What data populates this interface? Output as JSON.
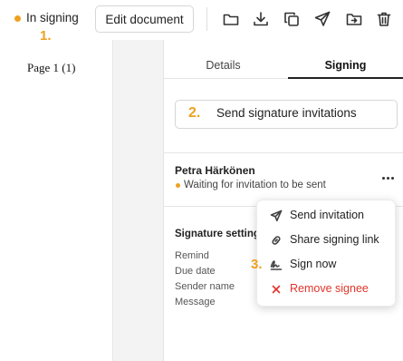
{
  "colors": {
    "accent": "#f0a020",
    "danger": "#e0352b",
    "text": "#222222"
  },
  "toolbar": {
    "status_label": "In signing",
    "step_1": "1.",
    "edit_document_label": "Edit document",
    "icons": [
      "folder-icon",
      "download-icon",
      "copy-icon",
      "send-icon",
      "move-to-folder-icon",
      "trash-icon"
    ]
  },
  "document": {
    "page_label": "Page  1 (1)"
  },
  "panel": {
    "tabs": [
      {
        "label": "Details",
        "active": false
      },
      {
        "label": "Signing",
        "active": true
      }
    ],
    "step_2": "2.",
    "send_invitations_label": "Send signature invitations",
    "signee": {
      "name": "Petra Härkönen",
      "status": "Waiting for invitation to be sent"
    },
    "signature_settings_title": "Signature settings",
    "settings": [
      "Remind",
      "Due date",
      "Sender name",
      "Message"
    ]
  },
  "menu": {
    "step_3": "3.",
    "items": [
      {
        "label": "Send invitation",
        "icon": "send-icon"
      },
      {
        "label": "Share signing link",
        "icon": "link-icon"
      },
      {
        "label": "Sign now",
        "icon": "signature-icon"
      },
      {
        "label": "Remove signee",
        "icon": "close-icon"
      }
    ]
  }
}
